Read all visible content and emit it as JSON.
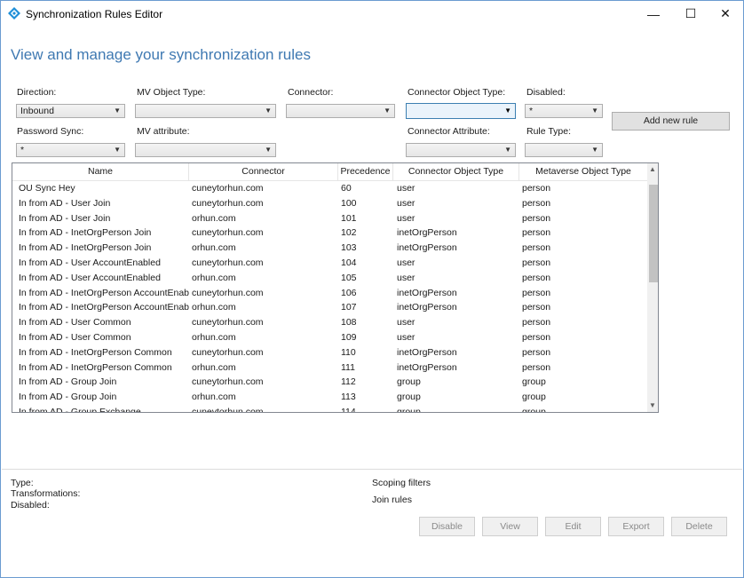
{
  "window": {
    "title": "Synchronization Rules Editor",
    "controls": {
      "minimize": "—",
      "maximize": "☐",
      "close": "✕"
    }
  },
  "heading": "View and manage your synchronization rules",
  "filters": {
    "direction": {
      "label": "Direction:",
      "value": "Inbound"
    },
    "mv_object_type": {
      "label": "MV Object Type:",
      "value": ""
    },
    "connector": {
      "label": "Connector:",
      "value": ""
    },
    "connector_object_type": {
      "label": "Connector Object Type:",
      "value": ""
    },
    "disabled": {
      "label": "Disabled:",
      "value": "*"
    },
    "password_sync": {
      "label": "Password Sync:",
      "value": "*"
    },
    "mv_attribute": {
      "label": "MV attribute:",
      "value": ""
    },
    "connector_attribute": {
      "label": "Connector Attribute:",
      "value": ""
    },
    "rule_type": {
      "label": "Rule Type:",
      "value": ""
    }
  },
  "add_rule_label": "Add new rule",
  "table": {
    "columns": [
      "Name",
      "Connector",
      "Precedence",
      "Connector Object Type",
      "Metaverse Object Type"
    ],
    "rows": [
      [
        "OU Sync Hey",
        "cuneytorhun.com",
        "60",
        "user",
        "person"
      ],
      [
        "In from AD - User Join",
        "cuneytorhun.com",
        "100",
        "user",
        "person"
      ],
      [
        "In from AD - User Join",
        "orhun.com",
        "101",
        "user",
        "person"
      ],
      [
        "In from AD - InetOrgPerson Join",
        "cuneytorhun.com",
        "102",
        "inetOrgPerson",
        "person"
      ],
      [
        "In from AD - InetOrgPerson Join",
        "orhun.com",
        "103",
        "inetOrgPerson",
        "person"
      ],
      [
        "In from AD - User AccountEnabled",
        "cuneytorhun.com",
        "104",
        "user",
        "person"
      ],
      [
        "In from AD - User AccountEnabled",
        "orhun.com",
        "105",
        "user",
        "person"
      ],
      [
        "In from AD - InetOrgPerson AccountEnabled",
        "cuneytorhun.com",
        "106",
        "inetOrgPerson",
        "person"
      ],
      [
        "In from AD - InetOrgPerson AccountEnabled",
        "orhun.com",
        "107",
        "inetOrgPerson",
        "person"
      ],
      [
        "In from AD - User Common",
        "cuneytorhun.com",
        "108",
        "user",
        "person"
      ],
      [
        "In from AD - User Common",
        "orhun.com",
        "109",
        "user",
        "person"
      ],
      [
        "In from AD - InetOrgPerson Common",
        "cuneytorhun.com",
        "110",
        "inetOrgPerson",
        "person"
      ],
      [
        "In from AD - InetOrgPerson Common",
        "orhun.com",
        "111",
        "inetOrgPerson",
        "person"
      ],
      [
        "In from AD - Group Join",
        "cuneytorhun.com",
        "112",
        "group",
        "group"
      ],
      [
        "In from AD - Group Join",
        "orhun.com",
        "113",
        "group",
        "group"
      ],
      [
        "In from AD - Group Exchange",
        "cuneytorhun.com",
        "114",
        "group",
        "group"
      ]
    ]
  },
  "details": {
    "type_label": "Type:",
    "transformations_label": "Transformations:",
    "disabled_label": "Disabled:",
    "scoping_filters_label": "Scoping filters",
    "join_rules_label": "Join rules"
  },
  "actions": {
    "disable": "Disable",
    "view": "View",
    "edit": "Edit",
    "export": "Export",
    "delete": "Delete"
  },
  "colors": {
    "heading": "#3f79b2",
    "accent_border": "#6b9bd1"
  }
}
